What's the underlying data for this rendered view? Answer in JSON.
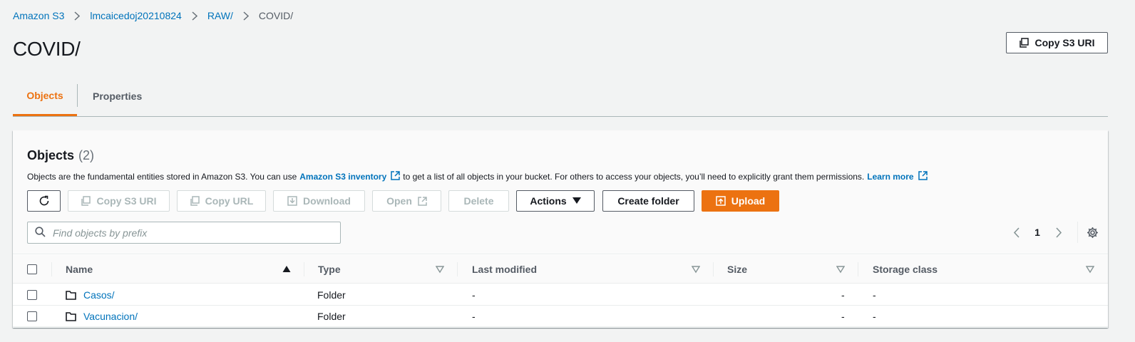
{
  "breadcrumb": {
    "items": [
      "Amazon S3",
      "lmcaicedoj20210824",
      "RAW/"
    ],
    "current": "COVID/"
  },
  "page_title": "COVID/",
  "header_actions": {
    "copy_s3_uri": "Copy S3 URI"
  },
  "tabs": [
    {
      "label": "Objects",
      "active": true
    },
    {
      "label": "Properties",
      "active": false
    }
  ],
  "objects_panel": {
    "title": "Objects",
    "count": "(2)",
    "description_part1": "Objects are the fundamental entities stored in Amazon S3. You can use",
    "inventory_link": "Amazon S3 inventory",
    "description_part2": "to get a list of all objects in your bucket. For others to access your objects, you’ll need to explicitly grant them permissions.",
    "learn_more": "Learn more"
  },
  "toolbar": {
    "copy_s3_uri": "Copy S3 URI",
    "copy_url": "Copy URL",
    "download": "Download",
    "open": "Open",
    "delete": "Delete",
    "actions": "Actions",
    "create_folder": "Create folder",
    "upload": "Upload"
  },
  "search": {
    "placeholder": "Find objects by prefix",
    "value": ""
  },
  "pagination": {
    "current_page": "1"
  },
  "table": {
    "columns": [
      "Name",
      "Type",
      "Last modified",
      "Size",
      "Storage class"
    ],
    "rows": [
      {
        "name": "Casos/",
        "type": "Folder",
        "last_modified": "-",
        "size": "-",
        "storage_class": "-"
      },
      {
        "name": "Vacunacion/",
        "type": "Folder",
        "last_modified": "-",
        "size": "-",
        "storage_class": "-"
      }
    ]
  },
  "colors": {
    "accent": "#ec7211",
    "link": "#0073bb",
    "text": "#16191f",
    "muted": "#545b64",
    "background": "#f2f3f3"
  }
}
